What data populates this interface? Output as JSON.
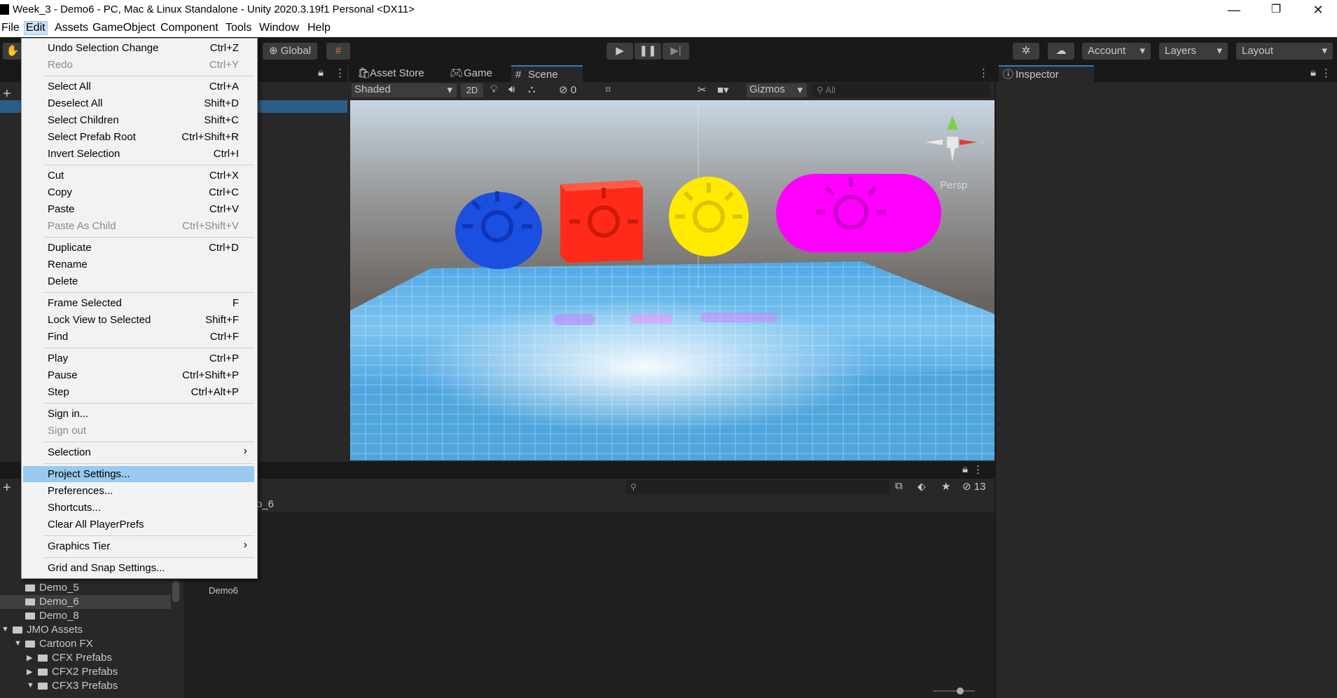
{
  "window": {
    "title": "Week_3 - Demo6 - PC, Mac & Linux Standalone - Unity 2020.3.19f1 Personal <DX11>",
    "minimize": "—",
    "maximize": "❐",
    "close": "✕"
  },
  "menubar": {
    "items": [
      "File",
      "Edit",
      "Assets",
      "GameObject",
      "Component",
      "Tools",
      "Window",
      "Help"
    ],
    "active": "Edit"
  },
  "toolbar": {
    "global_label": "Global",
    "account_label": "Account",
    "layers_label": "Layers",
    "layout_label": "Layout"
  },
  "scene_panel": {
    "tabs": [
      "Asset Store",
      "Game",
      "Scene"
    ],
    "selected_tab": "Scene",
    "shading_mode": "Shaded",
    "mode_2d": "2D",
    "hidden_count": "0",
    "gizmos_label": "Gizmos",
    "search_placeholder": "All",
    "persp_label": "Persp",
    "axis_y": "y",
    "axis_x": "x"
  },
  "inspector": {
    "tab_label": "Inspector"
  },
  "project_panel": {
    "hidden_count": "13",
    "breadcrumb_fragment": "o_6",
    "asset_item_label": "Demo6",
    "tree": [
      {
        "label": "Demo_5",
        "depth": 1,
        "selected": false,
        "expanded": null
      },
      {
        "label": "Demo_6",
        "depth": 1,
        "selected": true,
        "expanded": null
      },
      {
        "label": "Demo_8",
        "depth": 1,
        "selected": false,
        "expanded": null
      },
      {
        "label": "JMO Assets",
        "depth": 0,
        "selected": false,
        "expanded": true
      },
      {
        "label": "Cartoon FX",
        "depth": 1,
        "selected": false,
        "expanded": true
      },
      {
        "label": "CFX Prefabs",
        "depth": 2,
        "selected": false,
        "expanded": false
      },
      {
        "label": "CFX2 Prefabs",
        "depth": 2,
        "selected": false,
        "expanded": false
      },
      {
        "label": "CFX3 Prefabs",
        "depth": 2,
        "selected": false,
        "expanded": true
      }
    ]
  },
  "edit_menu": {
    "groups": [
      [
        {
          "label": "Undo Selection Change",
          "shortcut": "Ctrl+Z",
          "disabled": false
        },
        {
          "label": "Redo",
          "shortcut": "Ctrl+Y",
          "disabled": true
        }
      ],
      [
        {
          "label": "Select All",
          "shortcut": "Ctrl+A",
          "disabled": false
        },
        {
          "label": "Deselect All",
          "shortcut": "Shift+D",
          "disabled": false
        },
        {
          "label": "Select Children",
          "shortcut": "Shift+C",
          "disabled": false
        },
        {
          "label": "Select Prefab Root",
          "shortcut": "Ctrl+Shift+R",
          "disabled": false
        },
        {
          "label": "Invert Selection",
          "shortcut": "Ctrl+I",
          "disabled": false
        }
      ],
      [
        {
          "label": "Cut",
          "shortcut": "Ctrl+X",
          "disabled": false
        },
        {
          "label": "Copy",
          "shortcut": "Ctrl+C",
          "disabled": false
        },
        {
          "label": "Paste",
          "shortcut": "Ctrl+V",
          "disabled": false
        },
        {
          "label": "Paste As Child",
          "shortcut": "Ctrl+Shift+V",
          "disabled": true
        }
      ],
      [
        {
          "label": "Duplicate",
          "shortcut": "Ctrl+D",
          "disabled": false
        },
        {
          "label": "Rename",
          "shortcut": "",
          "disabled": false
        },
        {
          "label": "Delete",
          "shortcut": "",
          "disabled": false
        }
      ],
      [
        {
          "label": "Frame Selected",
          "shortcut": "F",
          "disabled": false
        },
        {
          "label": "Lock View to Selected",
          "shortcut": "Shift+F",
          "disabled": false
        },
        {
          "label": "Find",
          "shortcut": "Ctrl+F",
          "disabled": false
        }
      ],
      [
        {
          "label": "Play",
          "shortcut": "Ctrl+P",
          "disabled": false
        },
        {
          "label": "Pause",
          "shortcut": "Ctrl+Shift+P",
          "disabled": false
        },
        {
          "label": "Step",
          "shortcut": "Ctrl+Alt+P",
          "disabled": false
        }
      ],
      [
        {
          "label": "Sign in...",
          "shortcut": "",
          "disabled": false
        },
        {
          "label": "Sign out",
          "shortcut": "",
          "disabled": true
        }
      ],
      [
        {
          "label": "Selection",
          "shortcut": "",
          "disabled": false,
          "submenu": true
        }
      ],
      [
        {
          "label": "Project Settings...",
          "shortcut": "",
          "disabled": false,
          "highlighted": true
        },
        {
          "label": "Preferences...",
          "shortcut": "",
          "disabled": false
        },
        {
          "label": "Shortcuts...",
          "shortcut": "",
          "disabled": false
        },
        {
          "label": "Clear All PlayerPrefs",
          "shortcut": "",
          "disabled": false
        }
      ],
      [
        {
          "label": "Graphics Tier",
          "shortcut": "",
          "disabled": false,
          "submenu": true
        }
      ],
      [
        {
          "label": "Grid and Snap Settings...",
          "shortcut": "",
          "disabled": false
        }
      ]
    ]
  },
  "colors": {
    "editor_bg": "#282828",
    "toolbar_bg": "#191919",
    "menu_highlight": "#99c9ef",
    "blue_button": "#1a4fe0",
    "red_button": "#ff2a1a",
    "yellow_button": "#ffea00",
    "magenta_button": "#ff00ff",
    "floor": "#4aa8e8"
  }
}
